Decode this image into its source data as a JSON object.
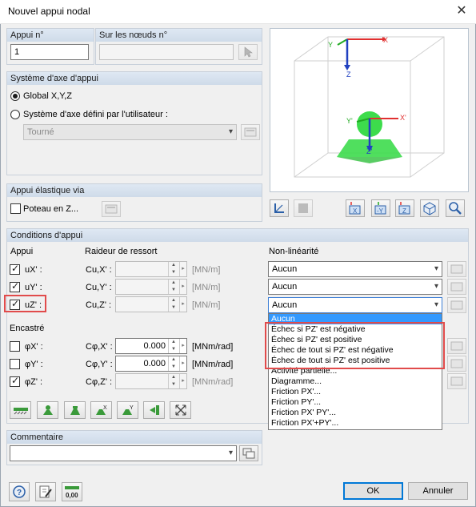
{
  "window": {
    "title": "Nouvel appui nodal",
    "close_glyph": "✕"
  },
  "appui_no": {
    "label": "Appui n°",
    "value": "1"
  },
  "noeuds": {
    "label": "Sur les nœuds n°",
    "value": ""
  },
  "axis_system": {
    "title": "Système d'axe d'appui",
    "global_label": "Global X,Y,Z",
    "user_label": "Système d'axe défini par l'utilisateur :",
    "combo_value": "Tourné"
  },
  "elastic": {
    "title": "Appui élastique via",
    "poteau_label": "Poteau en Z..."
  },
  "preview": {
    "labels": {
      "x": "X",
      "y": "Y",
      "z": "Z",
      "xp": "X'",
      "yp": "Y'",
      "zp": "Z'"
    }
  },
  "conditions": {
    "title": "Conditions d'appui",
    "col_appui": "Appui",
    "col_raideur": "Raideur de ressort",
    "col_nonlin": "Non-linéarité",
    "translations": [
      {
        "label": "uX' :",
        "coef": "Cu,X' :",
        "value": "",
        "unit": "[MN/m]",
        "checked": true,
        "nonlin": "Aucun"
      },
      {
        "label": "uY' :",
        "coef": "Cu,Y' :",
        "value": "",
        "unit": "[MN/m]",
        "checked": true,
        "nonlin": "Aucun"
      },
      {
        "label": "uZ' :",
        "coef": "Cu,Z' :",
        "value": "",
        "unit": "[MN/m]",
        "checked": true,
        "nonlin": "Aucun"
      }
    ],
    "encastre_title": "Encastré",
    "rotations": [
      {
        "label": "φX' :",
        "coef": "Cφ,X' :",
        "value": "0.000",
        "unit": "[MNm/rad]",
        "checked": false
      },
      {
        "label": "φY' :",
        "coef": "Cφ,Y' :",
        "value": "0.000",
        "unit": "[MNm/rad]",
        "checked": false
      },
      {
        "label": "φZ' :",
        "coef": "Cφ,Z' :",
        "value": "",
        "unit": "[MNm/rad]",
        "checked": true
      }
    ]
  },
  "dropdown": {
    "items": [
      "Aucun",
      "Échec si PZ' est négative",
      "Échec si PZ' est positive",
      "Échec de tout si PZ' est négative",
      "Échec de tout si PZ' est positive",
      "Activité partielle...",
      "Diagramme...",
      "Friction PX'...",
      "Friction PY'...",
      "Friction PX' PY'...",
      "Friction PX'+PY'..."
    ],
    "selected_index": 0
  },
  "comment": {
    "title": "Commentaire",
    "value": ""
  },
  "buttons": {
    "ok": "OK",
    "cancel": "Annuler",
    "units_icon_text": "0,00"
  },
  "colors": {
    "accent": "#0078d7",
    "highlight": "#e14b4b",
    "selection": "#3399ff",
    "support_green": "#3ddc4c"
  }
}
